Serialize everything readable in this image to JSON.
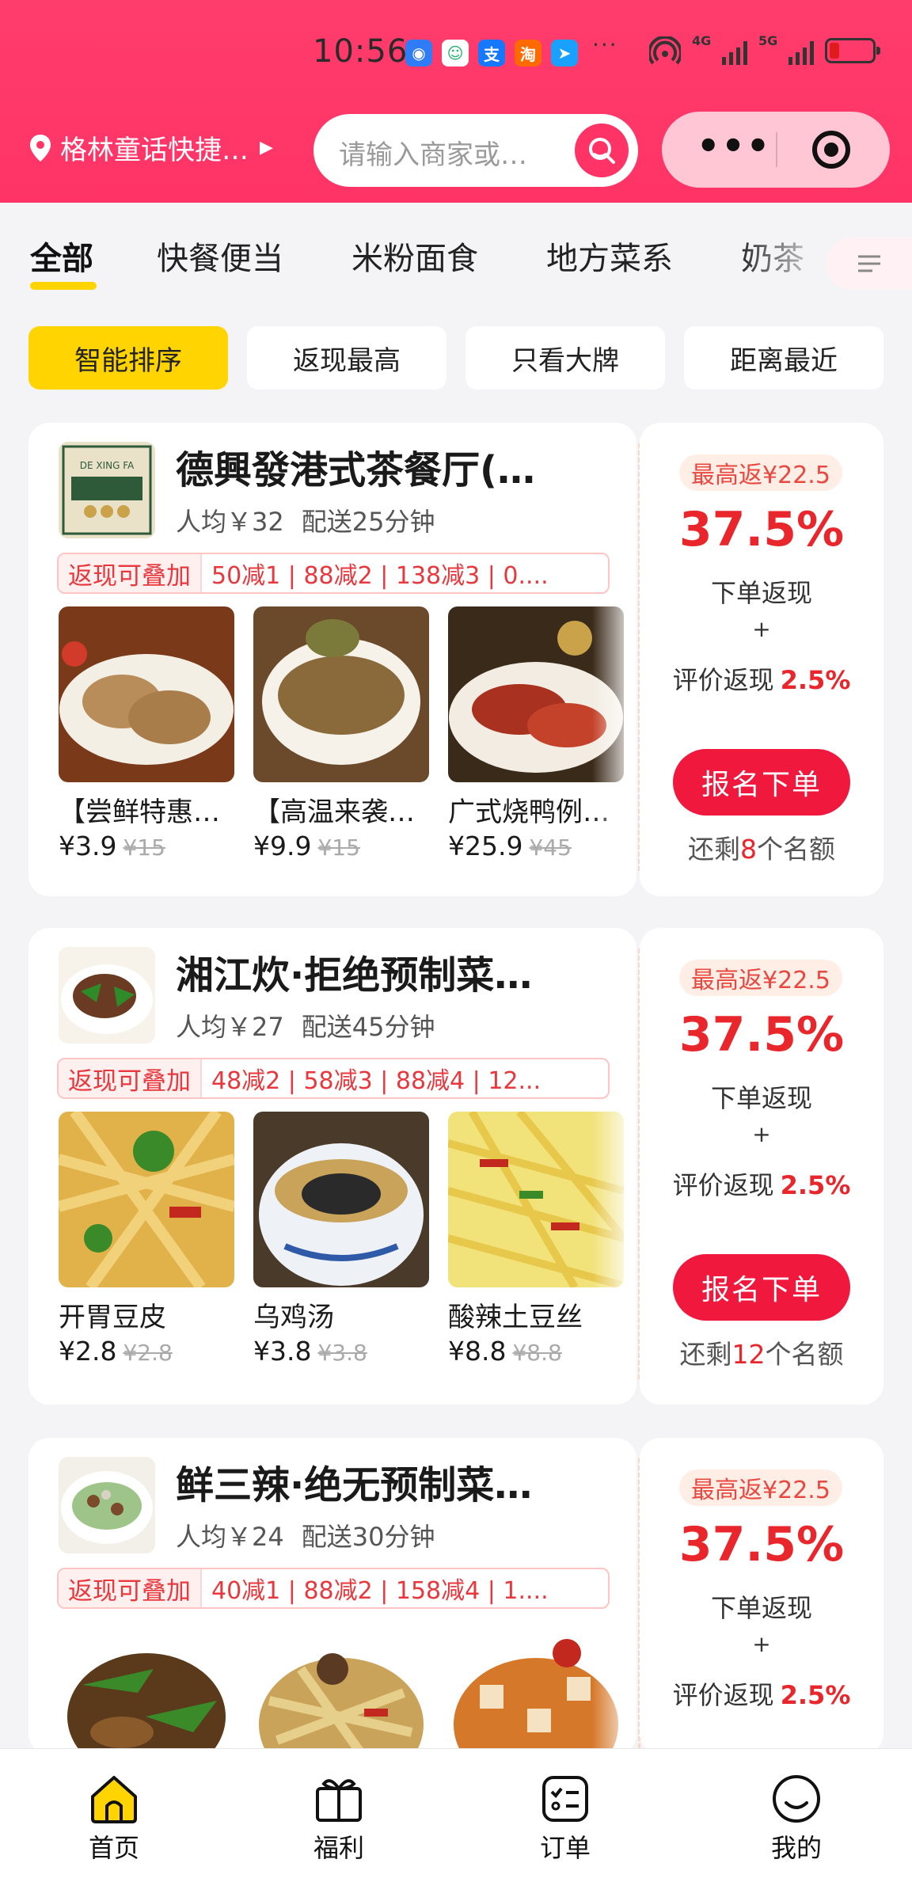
{
  "status_bar": {
    "time": "10:56",
    "overflow": "···",
    "network_1": "4G",
    "network_2": "5G",
    "battery_level": 0.2,
    "app_icons": [
      "browser-icon",
      "chat-icon",
      "alipay-icon",
      "taobao-icon",
      "map-icon"
    ]
  },
  "header": {
    "location": "格林童话快捷…",
    "search_placeholder": "请输入商家或…",
    "menu_dots": "•••",
    "accent": "#ff3366"
  },
  "tabs": [
    "全部",
    "快餐便当",
    "米粉面食",
    "地方菜系",
    "奶茶"
  ],
  "active_tab": "全部",
  "sort_chips": [
    "智能排序",
    "返现最高",
    "只看大牌",
    "距离最近"
  ],
  "active_sort": "智能排序",
  "merchants": [
    {
      "name": "德興發港式茶餐厅(…",
      "avg": "人均￥32",
      "delivery": "配送25分钟",
      "promo_tag": "返现可叠加",
      "promo_text": "50减1 | 88减2 | 138减3 | 0....",
      "dishes": [
        {
          "name": "【尝鲜特惠…",
          "price": "¥3.9",
          "orig": "¥15"
        },
        {
          "name": "【高温来袭…",
          "price": "¥9.9",
          "orig": "¥15"
        },
        {
          "name": "广式烧鸭例…",
          "price": "¥25.9",
          "orig": "¥45"
        }
      ],
      "rebate": {
        "max": "最高返¥22.5",
        "rate": "37.5%",
        "line1": "下单返现",
        "plus": "+",
        "line2": "评价返现",
        "line2_rate": "2.5%",
        "button": "报名下单",
        "remain_prefix": "还剩",
        "remain_count": "8",
        "remain_suffix": "个名额"
      }
    },
    {
      "name": "湘江炊·拒绝预制菜…",
      "avg": "人均￥27",
      "delivery": "配送45分钟",
      "promo_tag": "返现可叠加",
      "promo_text": "48减2 | 58减3 | 88减4 | 12...",
      "dishes": [
        {
          "name": "开胃豆皮",
          "price": "¥2.8",
          "orig": "¥2.8"
        },
        {
          "name": "乌鸡汤",
          "price": "¥3.8",
          "orig": "¥3.8"
        },
        {
          "name": "酸辣土豆丝",
          "price": "¥8.8",
          "orig": "¥8.8"
        }
      ],
      "rebate": {
        "max": "最高返¥22.5",
        "rate": "37.5%",
        "line1": "下单返现",
        "plus": "+",
        "line2": "评价返现",
        "line2_rate": "2.5%",
        "button": "报名下单",
        "remain_prefix": "还剩",
        "remain_count": "12",
        "remain_suffix": "个名额"
      }
    },
    {
      "name": "鲜三辣·绝无预制菜…",
      "avg": "人均￥24",
      "delivery": "配送30分钟",
      "promo_tag": "返现可叠加",
      "promo_text": "40减1 | 88减2 | 158减4 | 1....",
      "rebate": {
        "max": "最高返¥22.5",
        "rate": "37.5%",
        "line1": "下单返现",
        "plus": "+",
        "line2": "评价返现",
        "line2_rate": "2.5%"
      }
    }
  ],
  "bottom_nav": [
    "首页",
    "福利",
    "订单",
    "我的"
  ],
  "active_nav": "首页"
}
